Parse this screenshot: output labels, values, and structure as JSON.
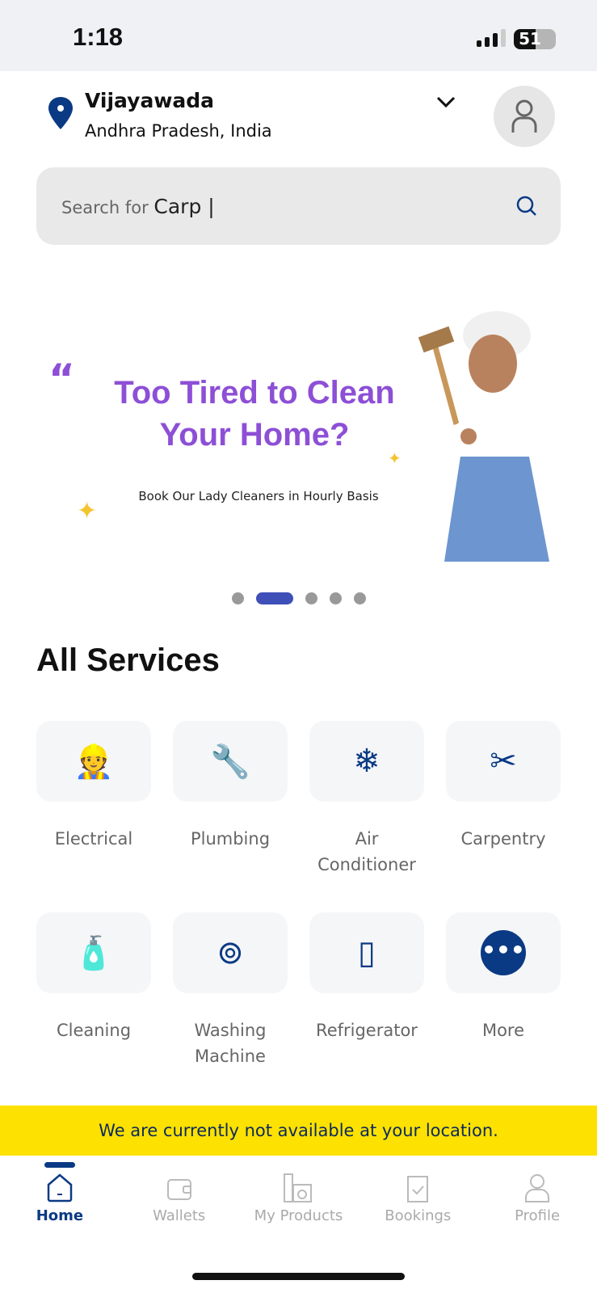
{
  "status": {
    "time": "1:18",
    "battery": "51",
    "battery_level": 51
  },
  "header": {
    "city": "Vijayawada",
    "region": "Andhra Pradesh, India"
  },
  "search": {
    "placeholder": "Search for",
    "typed": "Carp |"
  },
  "promo": {
    "headline": "Too Tired to Clean Your Home?",
    "subtext": "Book Our Lady Cleaners in Hourly Basis",
    "quote_mark": "“",
    "slides": 5,
    "active_slide": 2
  },
  "services": {
    "title": "All Services",
    "items": [
      {
        "label": "Electrical",
        "icon": "electrician-icon"
      },
      {
        "label": "Plumbing",
        "icon": "pipe-icon"
      },
      {
        "label": "Air Conditioner",
        "icon": "ac-icon"
      },
      {
        "label": "Carpentry",
        "icon": "tools-icon"
      },
      {
        "label": "Cleaning",
        "icon": "cleaning-supplies-icon"
      },
      {
        "label": "Washing Machine",
        "icon": "washing-machine-icon"
      },
      {
        "label": "Refrigerator",
        "icon": "fridge-icon"
      },
      {
        "label": "More",
        "icon": "more-icon"
      }
    ]
  },
  "notice": "We are currently not available at your location.",
  "nav": [
    {
      "label": "Home",
      "active": true
    },
    {
      "label": "Wallets"
    },
    {
      "label": "My Products"
    },
    {
      "label": "Bookings"
    },
    {
      "label": "Profile"
    }
  ],
  "colors": {
    "primary": "#0b3a84",
    "accent": "#3e4fb8",
    "notice_bg": "#fde100",
    "promo_text": "#8d4fd6"
  }
}
